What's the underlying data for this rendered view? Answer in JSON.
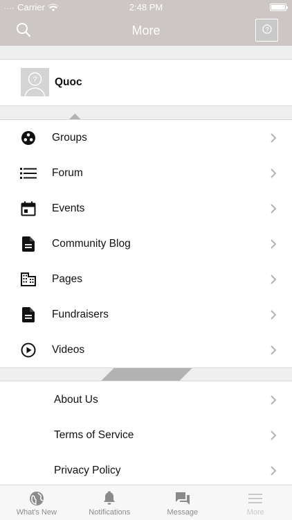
{
  "status_bar": {
    "carrier": "Carrier",
    "time": "2:48 PM"
  },
  "header": {
    "title": "More"
  },
  "profile": {
    "name": "Quoc"
  },
  "menu": {
    "items": [
      {
        "label": "Groups",
        "icon": "groups-icon"
      },
      {
        "label": "Forum",
        "icon": "list-icon"
      },
      {
        "label": "Events",
        "icon": "calendar-icon"
      },
      {
        "label": "Community Blog",
        "icon": "document-icon"
      },
      {
        "label": "Pages",
        "icon": "building-icon"
      },
      {
        "label": "Fundraisers",
        "icon": "document-icon"
      },
      {
        "label": "Videos",
        "icon": "play-circle-icon"
      }
    ]
  },
  "links": {
    "items": [
      {
        "label": "About Us"
      },
      {
        "label": "Terms of Service"
      },
      {
        "label": "Privacy Policy"
      }
    ]
  },
  "tabbar": {
    "tabs": [
      {
        "label": "What's New",
        "icon": "globe-icon"
      },
      {
        "label": "Notifications",
        "icon": "bell-icon"
      },
      {
        "label": "Message",
        "icon": "chat-icon"
      },
      {
        "label": "More",
        "icon": "menu-icon"
      }
    ]
  },
  "colors": {
    "header_bg": "#ccc6c4",
    "active_tab": "#c8c8c8"
  }
}
